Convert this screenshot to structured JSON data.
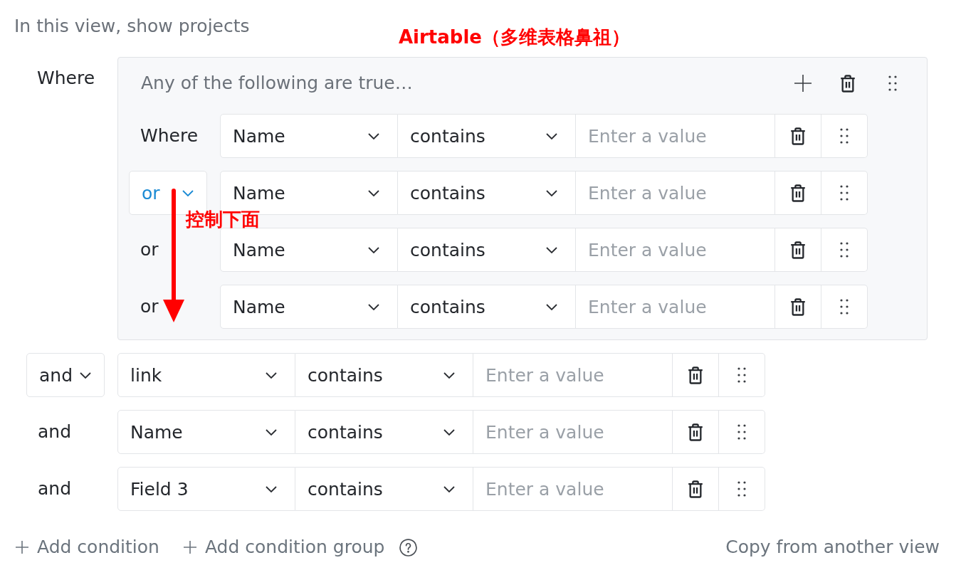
{
  "heading": "In this view, show projects",
  "annotations": {
    "title": "Airtable（多维表格鼻祖）",
    "arrow_label": "控制下面"
  },
  "filter": {
    "where_label": "Where",
    "group": {
      "header": "Any of the following are true…",
      "conditions": [
        {
          "conjunction": {
            "kind": "label",
            "text": "Where"
          },
          "field": "Name",
          "operator": "contains",
          "value": {
            "placeholder": "Enter a value"
          }
        },
        {
          "conjunction": {
            "kind": "dropdown",
            "text": "or",
            "hovered": true
          },
          "field": "Name",
          "operator": "contains",
          "value": {
            "placeholder": "Enter a value"
          }
        },
        {
          "conjunction": {
            "kind": "label",
            "text": "or"
          },
          "field": "Name",
          "operator": "contains",
          "value": {
            "placeholder": "Enter a value"
          }
        },
        {
          "conjunction": {
            "kind": "label",
            "text": "or"
          },
          "field": "Name",
          "operator": "contains",
          "value": {
            "placeholder": "Enter a value"
          }
        }
      ]
    },
    "conditions": [
      {
        "conjunction": {
          "kind": "dropdown",
          "text": "and",
          "hovered": false
        },
        "field": "link",
        "operator": "contains",
        "value": {
          "placeholder": "Enter a value"
        }
      },
      {
        "conjunction": {
          "kind": "label",
          "text": "and"
        },
        "field": "Name",
        "operator": "contains",
        "value": {
          "placeholder": "Enter a value"
        }
      },
      {
        "conjunction": {
          "kind": "label",
          "text": "and"
        },
        "field": "Field 3",
        "operator": "contains",
        "value": {
          "placeholder": "Enter a value"
        }
      }
    ]
  },
  "footer": {
    "add_condition": "Add condition",
    "add_group": "Add condition group",
    "copy": "Copy from another view"
  }
}
